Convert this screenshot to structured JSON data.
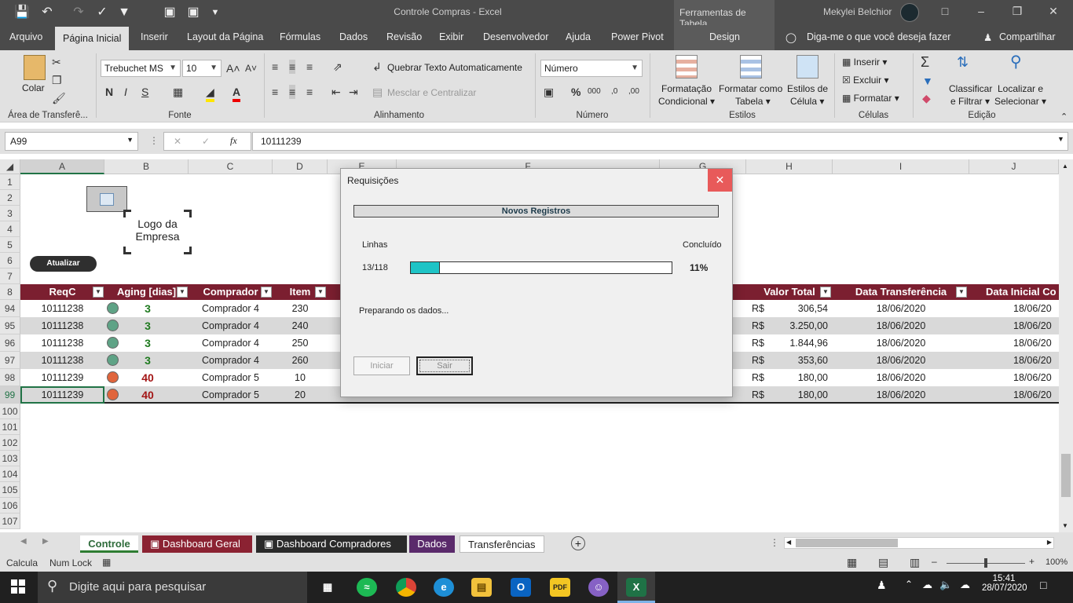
{
  "window": {
    "title": "Controle Compras  -  Excel",
    "context_tab": "Ferramentas de Tabela",
    "user": "Mekylei Belchior"
  },
  "tabs": [
    "Arquivo",
    "Página Inicial",
    "Inserir",
    "Layout da Página",
    "Fórmulas",
    "Dados",
    "Revisão",
    "Exibir",
    "Desenvolvedor",
    "Ajuda",
    "Power Pivot",
    "Design"
  ],
  "tell_me": "Diga-me o que você deseja fazer",
  "share": "Compartilhar",
  "ribbon": {
    "clipboard": {
      "label": "Área de Transferê...",
      "paste": "Colar"
    },
    "font": {
      "label": "Fonte",
      "name": "Trebuchet MS",
      "size": "10"
    },
    "alignment": {
      "label": "Alinhamento",
      "wrap": "Quebrar Texto Automaticamente",
      "merge": "Mesclar e Centralizar"
    },
    "number": {
      "label": "Número",
      "format": "Número"
    },
    "styles": {
      "label": "Estilos",
      "cond1": "Formatação",
      "cond2": "Condicional",
      "table1": "Formatar como",
      "table2": "Tabela",
      "cell1": "Estilos de",
      "cell2": "Célula"
    },
    "cells": {
      "label": "Células",
      "insert": "Inserir",
      "delete": "Excluir",
      "format": "Formatar"
    },
    "editing": {
      "label": "Edição",
      "sort1": "Classificar",
      "sort2": "e Filtrar",
      "find1": "Localizar e",
      "find2": "Selecionar"
    }
  },
  "formula_bar": {
    "name_box": "A99",
    "fx": "fx",
    "value": "10111239"
  },
  "columns": [
    "A",
    "B",
    "C",
    "D",
    "E",
    "F",
    "G",
    "H",
    "I",
    "J"
  ],
  "rows_top": [
    "1",
    "2",
    "3",
    "4",
    "5",
    "6",
    "7",
    "8"
  ],
  "logo_text": [
    "Logo da",
    "Empresa"
  ],
  "update_button": "Atualizar",
  "table_headers": [
    "ReqC",
    "Aging [dias]",
    "Comprador",
    "Item",
    "Valor Total",
    "Data Transferência",
    "Data Inicial Co"
  ],
  "table_rows": [
    {
      "row": "94",
      "reqc": "10111238",
      "status": "green",
      "aging": "3",
      "buyer": "Comprador 4",
      "item": "230",
      "cur": "R$",
      "value": "306,54",
      "date": "18/06/2020",
      "date2": "18/06/20"
    },
    {
      "row": "95",
      "reqc": "10111238",
      "status": "green",
      "aging": "3",
      "buyer": "Comprador 4",
      "item": "240",
      "cur": "R$",
      "value": "3.250,00",
      "date": "18/06/2020",
      "date2": "18/06/20"
    },
    {
      "row": "96",
      "reqc": "10111238",
      "status": "green",
      "aging": "3",
      "buyer": "Comprador 4",
      "item": "250",
      "cur": "R$",
      "value": "1.844,96",
      "date": "18/06/2020",
      "date2": "18/06/20"
    },
    {
      "row": "97",
      "reqc": "10111238",
      "status": "green",
      "aging": "3",
      "buyer": "Comprador 4",
      "item": "260",
      "cur": "R$",
      "value": "353,60",
      "date": "18/06/2020",
      "date2": "18/06/20"
    },
    {
      "row": "98",
      "reqc": "10111239",
      "status": "red",
      "aging": "40",
      "buyer": "Comprador 5",
      "item": "10",
      "cur": "R$",
      "value": "180,00",
      "date": "18/06/2020",
      "date2": "18/06/20"
    },
    {
      "row": "99",
      "reqc": "10111239",
      "status": "red",
      "aging": "40",
      "buyer": "Comprador 5",
      "item": "20",
      "cur": "R$",
      "value": "180,00",
      "date": "18/06/2020",
      "date2": "18/06/20"
    }
  ],
  "rows_bottom": [
    "100",
    "101",
    "102",
    "103",
    "104",
    "105",
    "106",
    "107"
  ],
  "dialog": {
    "title": "Requisições",
    "banner": "Novos Registros",
    "lines_label": "Linhas",
    "done_label": "Concluído",
    "count": "13/118",
    "percent": "11%",
    "progress": 0.11,
    "status": "Preparando os dados...",
    "start": "Iniciar",
    "exit": "Sair"
  },
  "sheet_tabs": [
    {
      "label": "Controle",
      "style": "active-green"
    },
    {
      "label": "Dashboard Geral",
      "style": "red"
    },
    {
      "label": "Dashboard Compradores",
      "style": "dark"
    },
    {
      "label": "Dados",
      "style": "purple"
    },
    {
      "label": "Transferências",
      "style": "white"
    }
  ],
  "statusbar": {
    "calc": "Calcula",
    "numlock": "Num Lock",
    "zoom": "100%"
  },
  "taskbar": {
    "search": "Digite aqui para pesquisar",
    "time": "15:41",
    "date": "28/07/2020"
  },
  "colors": {
    "header_bg": "#7b1f30",
    "green_dot": "#5fa386",
    "red_dot": "#e0653c",
    "progress": "#1fc4c6"
  }
}
